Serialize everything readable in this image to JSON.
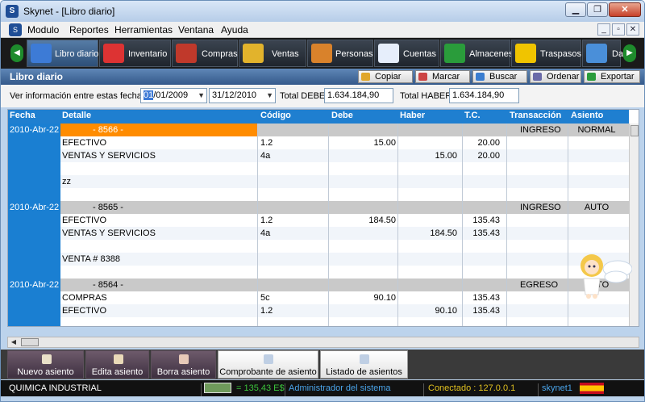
{
  "window": {
    "title": "Skynet - [Libro diario]",
    "app_icon": "S"
  },
  "menu": [
    "Modulo",
    "Reportes",
    "Herramientas",
    "Ventana",
    "Ayuda"
  ],
  "toolbar": [
    {
      "label": "Libro diario",
      "icon": "book-icon",
      "color": "#3d7bd6"
    },
    {
      "label": "Inventario",
      "icon": "box-icon",
      "color": "#d33"
    },
    {
      "label": "Compras",
      "icon": "cart-icon",
      "color": "#c0392b"
    },
    {
      "label": "Ventas",
      "icon": "coins-icon",
      "color": "#e2b32c"
    },
    {
      "label": "Personas",
      "icon": "people-icon",
      "color": "#d9822b"
    },
    {
      "label": "Cuentas",
      "icon": "ledger-icon",
      "color": "#e6eefb"
    },
    {
      "label": "Almacenes",
      "icon": "warehouse-icon",
      "color": "#2a9c3b"
    },
    {
      "label": "Traspasos",
      "icon": "transfer-icon",
      "color": "#f0c400"
    },
    {
      "label": "Da",
      "icon": "chart-icon",
      "color": "#4a8fd9"
    }
  ],
  "subheader": {
    "title": "Libro diario"
  },
  "actions": [
    {
      "label": "Copiar",
      "icon": "copy-icon",
      "color": "#e0a62a"
    },
    {
      "label": "Marcar",
      "icon": "mark-icon",
      "color": "#c44"
    },
    {
      "label": "Buscar",
      "icon": "search-icon",
      "color": "#3a7dd0"
    },
    {
      "label": "Ordenar",
      "icon": "sort-icon",
      "color": "#6a6aa8"
    },
    {
      "label": "Exportar",
      "icon": "export-icon",
      "color": "#2a9c3b"
    }
  ],
  "filter": {
    "label": "Ver información entre estas fechas:",
    "date_from": "01/01/2009",
    "date_to": "31/12/2010",
    "total_debe_label": "Total DEBE:",
    "total_debe": "1.634.184,90",
    "total_haber_label": "Total HABER:",
    "total_haber": "1.634.184,90"
  },
  "table": {
    "columns": [
      "Fecha",
      "Detalle",
      "Código",
      "Debe",
      "Haber",
      "T.C.",
      "Transacción",
      "Asiento"
    ],
    "groups": [
      {
        "fecha": "2010-Abr-22",
        "number": "- 8566 -",
        "transaccion": "INGRESO",
        "asiento": "NORMAL",
        "highlight": true,
        "rows": [
          {
            "detalle": "EFECTIVO",
            "codigo": "1.2",
            "debe": "15.00",
            "haber": "",
            "tc": "20.00"
          },
          {
            "detalle": "VENTAS Y SERVICIOS",
            "codigo": "4a",
            "debe": "",
            "haber": "15.00",
            "tc": "20.00"
          },
          {
            "detalle": "",
            "codigo": "",
            "debe": "",
            "haber": "",
            "tc": ""
          },
          {
            "detalle": "zz",
            "codigo": "",
            "debe": "",
            "haber": "",
            "tc": ""
          },
          {
            "detalle": "",
            "codigo": "",
            "debe": "",
            "haber": "",
            "tc": ""
          }
        ]
      },
      {
        "fecha": "2010-Abr-22",
        "number": "- 8565 -",
        "transaccion": "INGRESO",
        "asiento": "AUTO",
        "highlight": false,
        "rows": [
          {
            "detalle": "EFECTIVO",
            "codigo": "1.2",
            "debe": "184.50",
            "haber": "",
            "tc": "135.43"
          },
          {
            "detalle": "VENTAS Y SERVICIOS",
            "codigo": "4a",
            "debe": "",
            "haber": "184.50",
            "tc": "135.43"
          },
          {
            "detalle": "",
            "codigo": "",
            "debe": "",
            "haber": "",
            "tc": ""
          },
          {
            "detalle": "VENTA # 8388",
            "codigo": "",
            "debe": "",
            "haber": "",
            "tc": ""
          },
          {
            "detalle": "",
            "codigo": "",
            "debe": "",
            "haber": "",
            "tc": ""
          }
        ]
      },
      {
        "fecha": "2010-Abr-22",
        "number": "- 8564 -",
        "transaccion": "EGRESO",
        "asiento": "AUTO",
        "highlight": false,
        "rows": [
          {
            "detalle": "COMPRAS",
            "codigo": "5c",
            "debe": "90.10",
            "haber": "",
            "tc": "135.43"
          },
          {
            "detalle": "EFECTIVO",
            "codigo": "1.2",
            "debe": "",
            "haber": "90.10",
            "tc": "135.43"
          },
          {
            "detalle": "",
            "codigo": "",
            "debe": "",
            "haber": "",
            "tc": ""
          }
        ]
      }
    ]
  },
  "bottom_buttons": [
    {
      "label": "Nuevo asiento",
      "icon": "new-doc-icon",
      "style": "dark"
    },
    {
      "label": "Edita asiento",
      "icon": "edit-doc-icon",
      "style": "dark"
    },
    {
      "label": "Borra asiento",
      "icon": "delete-doc-icon",
      "style": "dark"
    },
    {
      "label": "Comprobante de asiento",
      "icon": "receipt-icon",
      "style": "light"
    },
    {
      "label": "Listado de asientos",
      "icon": "list-icon",
      "style": "light"
    }
  ],
  "status": {
    "company": "QUIMICA INDUSTRIAL",
    "exchange": "= 135,43 E$",
    "user": "Administrador del sistema",
    "connection": "Conectado : 127.0.0.1",
    "login": "skynet1"
  }
}
